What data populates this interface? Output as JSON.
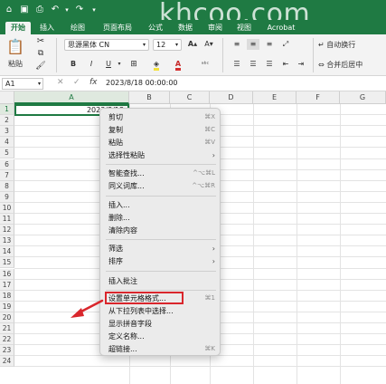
{
  "watermark": "khcoo.com",
  "tabs": [
    "开始",
    "插入",
    "绘图",
    "页面布局",
    "公式",
    "数据",
    "审阅",
    "视图",
    "Acrobat"
  ],
  "ribbon": {
    "paste_label": "粘贴",
    "font_name": "思源黑体 CN",
    "font_size": "12",
    "bold": "B",
    "italic": "I",
    "underline": "U",
    "wrap_text": "自动换行",
    "merge_center": "合并后居中"
  },
  "formula_bar": {
    "cell_ref": "A1",
    "fx": "fx",
    "value": "2023/8/18  00:00:00"
  },
  "grid": {
    "columns": [
      "A",
      "B",
      "C",
      "D",
      "E",
      "F",
      "G"
    ],
    "rows": [
      "1",
      "2",
      "3",
      "4",
      "5",
      "6",
      "7",
      "8",
      "9",
      "10",
      "11",
      "12",
      "13",
      "14",
      "15",
      "16",
      "17",
      "18",
      "19",
      "20",
      "21",
      "22",
      "23",
      "24"
    ],
    "a1_value": "2023/8/18"
  },
  "menu": {
    "cut": "剪切",
    "cut_sc": "⌘X",
    "copy": "复制",
    "copy_sc": "⌘C",
    "paste": "粘贴",
    "paste_sc": "⌘V",
    "paste_special": "选择性粘贴",
    "smart_lookup": "智能查找...",
    "smart_lookup_sc": "^⌥⌘L",
    "thesaurus": "同义词库...",
    "thesaurus_sc": "^⌥⌘R",
    "insert": "插入...",
    "delete": "删除...",
    "clear": "清除内容",
    "filter": "筛选",
    "sort": "排序",
    "insert_comment": "插入批注",
    "format_cells": "设置单元格格式...",
    "format_cells_sc": "⌘1",
    "pick_list": "从下拉列表中选择...",
    "phonetic": "显示拼音字段",
    "define_name": "定义名称...",
    "hyperlink": "超链接...",
    "hyperlink_sc": "⌘K"
  },
  "colors": {
    "excel_green": "#1f7a43",
    "highlight_red": "#d9262c"
  }
}
